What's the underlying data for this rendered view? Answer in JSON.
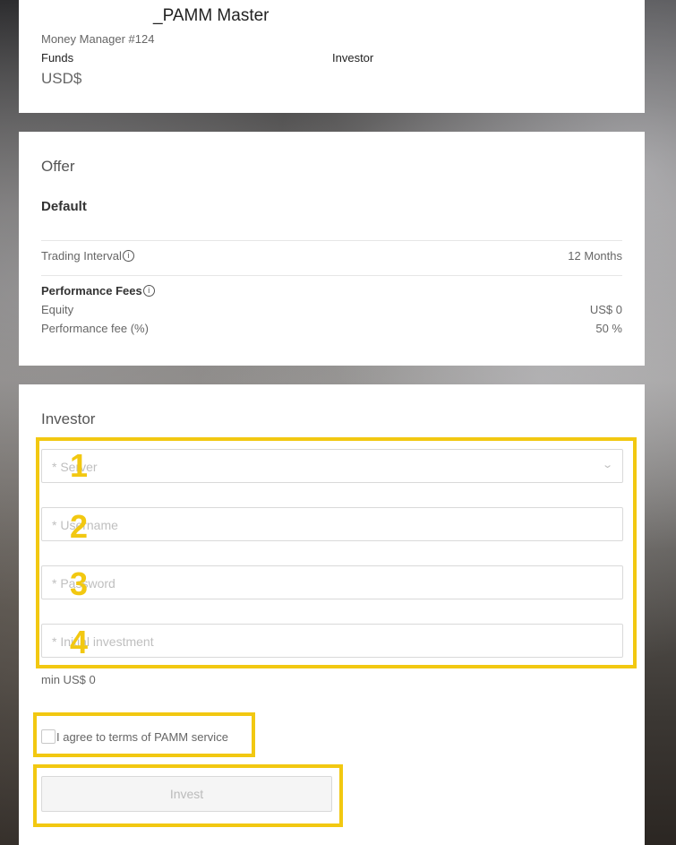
{
  "manager": {
    "title": "_PAMM Master",
    "subtitle": "Money Manager #124",
    "funds_label": "Funds",
    "investor_label": "Investor",
    "currency": "USD$"
  },
  "offer": {
    "section_title": "Offer",
    "name": "Default",
    "trading_interval_label": "Trading Interval",
    "trading_interval_value": "12 Months",
    "performance_fees_label": "Performance Fees",
    "equity_label": "Equity",
    "equity_value": "US$ 0",
    "performance_fee_label": "Performance fee (%)",
    "performance_fee_value": "50 %",
    "info_icon_glyph": "i"
  },
  "investor": {
    "section_title": "Investor",
    "fields": [
      {
        "placeholder": "* Server",
        "marker": "1"
      },
      {
        "placeholder": "* Username",
        "marker": "2"
      },
      {
        "placeholder": "* Password",
        "marker": "3"
      },
      {
        "placeholder": "* Initial investment",
        "marker": "4"
      }
    ],
    "min_note": "min US$ 0",
    "agree_label": "I agree to terms of PAMM service",
    "invest_button": "Invest",
    "chevron_glyph": "⌄"
  },
  "colors": {
    "highlight": "#f2c811",
    "card_bg": "#ffffff"
  }
}
